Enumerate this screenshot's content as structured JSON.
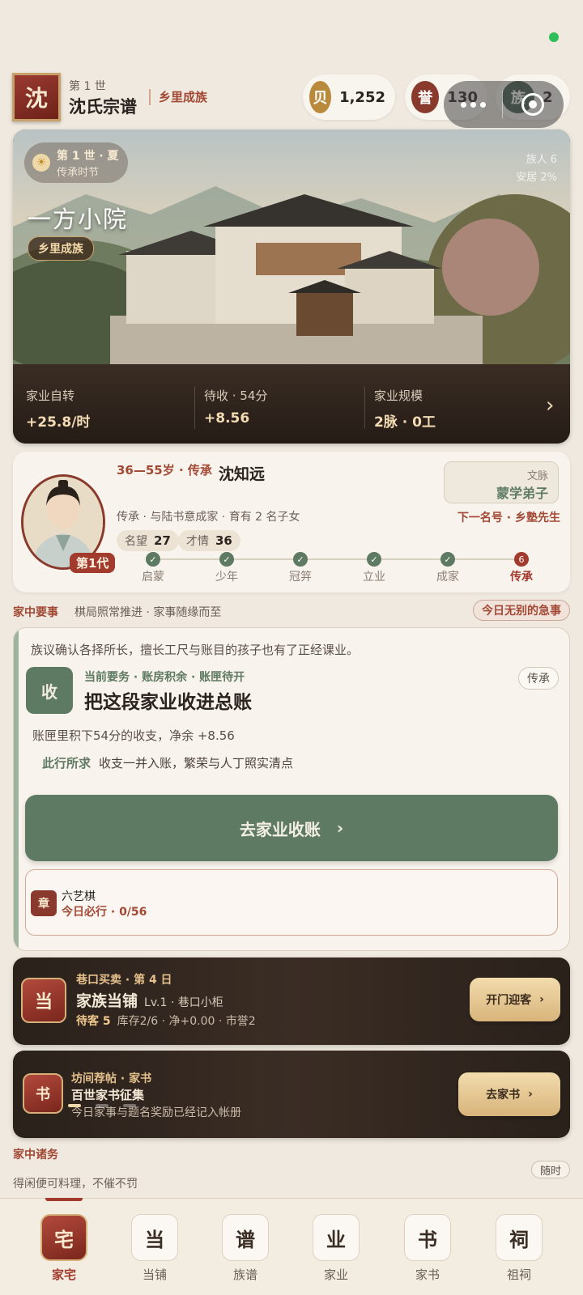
{
  "header": {
    "seal": "沈",
    "generation": "第 1 世",
    "clan_title": "沈氏宗谱",
    "rank": "乡里成族"
  },
  "resources": [
    {
      "icon": "贝",
      "value": "1,252",
      "color": "#b98a3c"
    },
    {
      "icon": "誉",
      "value": "130",
      "color": "#8a3a2c"
    },
    {
      "icon": "族",
      "value": "2",
      "color": "#3f5a4a"
    }
  ],
  "hero": {
    "season": "第 1 世 · 夏",
    "season_sub": "传承时节",
    "title": "一方小院",
    "badge": "乡里成族",
    "members": "族人 6",
    "happiness": "安居 2%",
    "stats": [
      {
        "label": "家业自转",
        "value": "+25.8/时"
      },
      {
        "label": "待收 · 54分",
        "value": "+8.56"
      },
      {
        "label": "家业规模",
        "value": "2脉 · 0工"
      }
    ],
    "arrow": "›"
  },
  "heir": {
    "age_stage": "36—55岁 · 传承",
    "name": "沈知远",
    "desc": "传承 · 与陆书意成家 · 育有 2 名子女",
    "gen_tag": "第1代",
    "attrs": [
      {
        "label": "名望",
        "value": "27"
      },
      {
        "label": "才情",
        "value": "36"
      }
    ],
    "style_label": "文脉",
    "style_value": "蒙学弟子",
    "next_title": "下一名号 · 乡塾先生",
    "steps": [
      "启蒙",
      "少年",
      "冠笄",
      "立业",
      "成家",
      "传承"
    ],
    "current_step_num": "6"
  },
  "matters": {
    "title": "家中要事",
    "subtitle": "棋局照常推进 · 家事随缘而至",
    "urgent": "今日无别的急事",
    "intro": "族议确认各择所长，擅长工尺与账目的孩子也有了正经课业。",
    "seal": "收",
    "kicker": "当前要务 · 账房积余 · 账匣待开",
    "task_title": "把这段家业收进总账",
    "tag": "传承",
    "line1": "账匣里积下54分的收支，净余 +8.56",
    "line2_label": "此行所求",
    "line2": "收支一并入账，繁荣与人丁照实清点",
    "button": "去家业收账",
    "sub_seal": "章",
    "sub_name": "六艺棋",
    "sub_progress": "今日必行 · 0/56"
  },
  "shop": {
    "seal": "当",
    "kicker": "巷口买卖 · 第 4 日",
    "title": "家族当铺",
    "level": "Lv.1 · 巷口小柜",
    "customers": "待客 5",
    "meta": "库存2/6 · 净+0.00 · 市誉2",
    "button": "开门迎客"
  },
  "letter": {
    "seal": "书",
    "kicker": "坊间荐帖 · 家书",
    "title": "百世家书征集",
    "desc": "今日家事与题名奖励已经记入帐册",
    "button": "去家书"
  },
  "chores": {
    "title": "家中诸务",
    "subtitle": "得闲便可料理，不催不罚",
    "tag": "随时"
  },
  "tabs": [
    {
      "icon": "宅",
      "label": "家宅",
      "active": true
    },
    {
      "icon": "当",
      "label": "当铺"
    },
    {
      "icon": "谱",
      "label": "族谱"
    },
    {
      "icon": "业",
      "label": "家业"
    },
    {
      "icon": "书",
      "label": "家书"
    },
    {
      "icon": "祠",
      "label": "祖祠"
    }
  ],
  "colors": {
    "accent_red": "#a23a2e",
    "accent_green": "#5e7a62",
    "gold": "#d8b47a",
    "background": "#efe9df"
  }
}
